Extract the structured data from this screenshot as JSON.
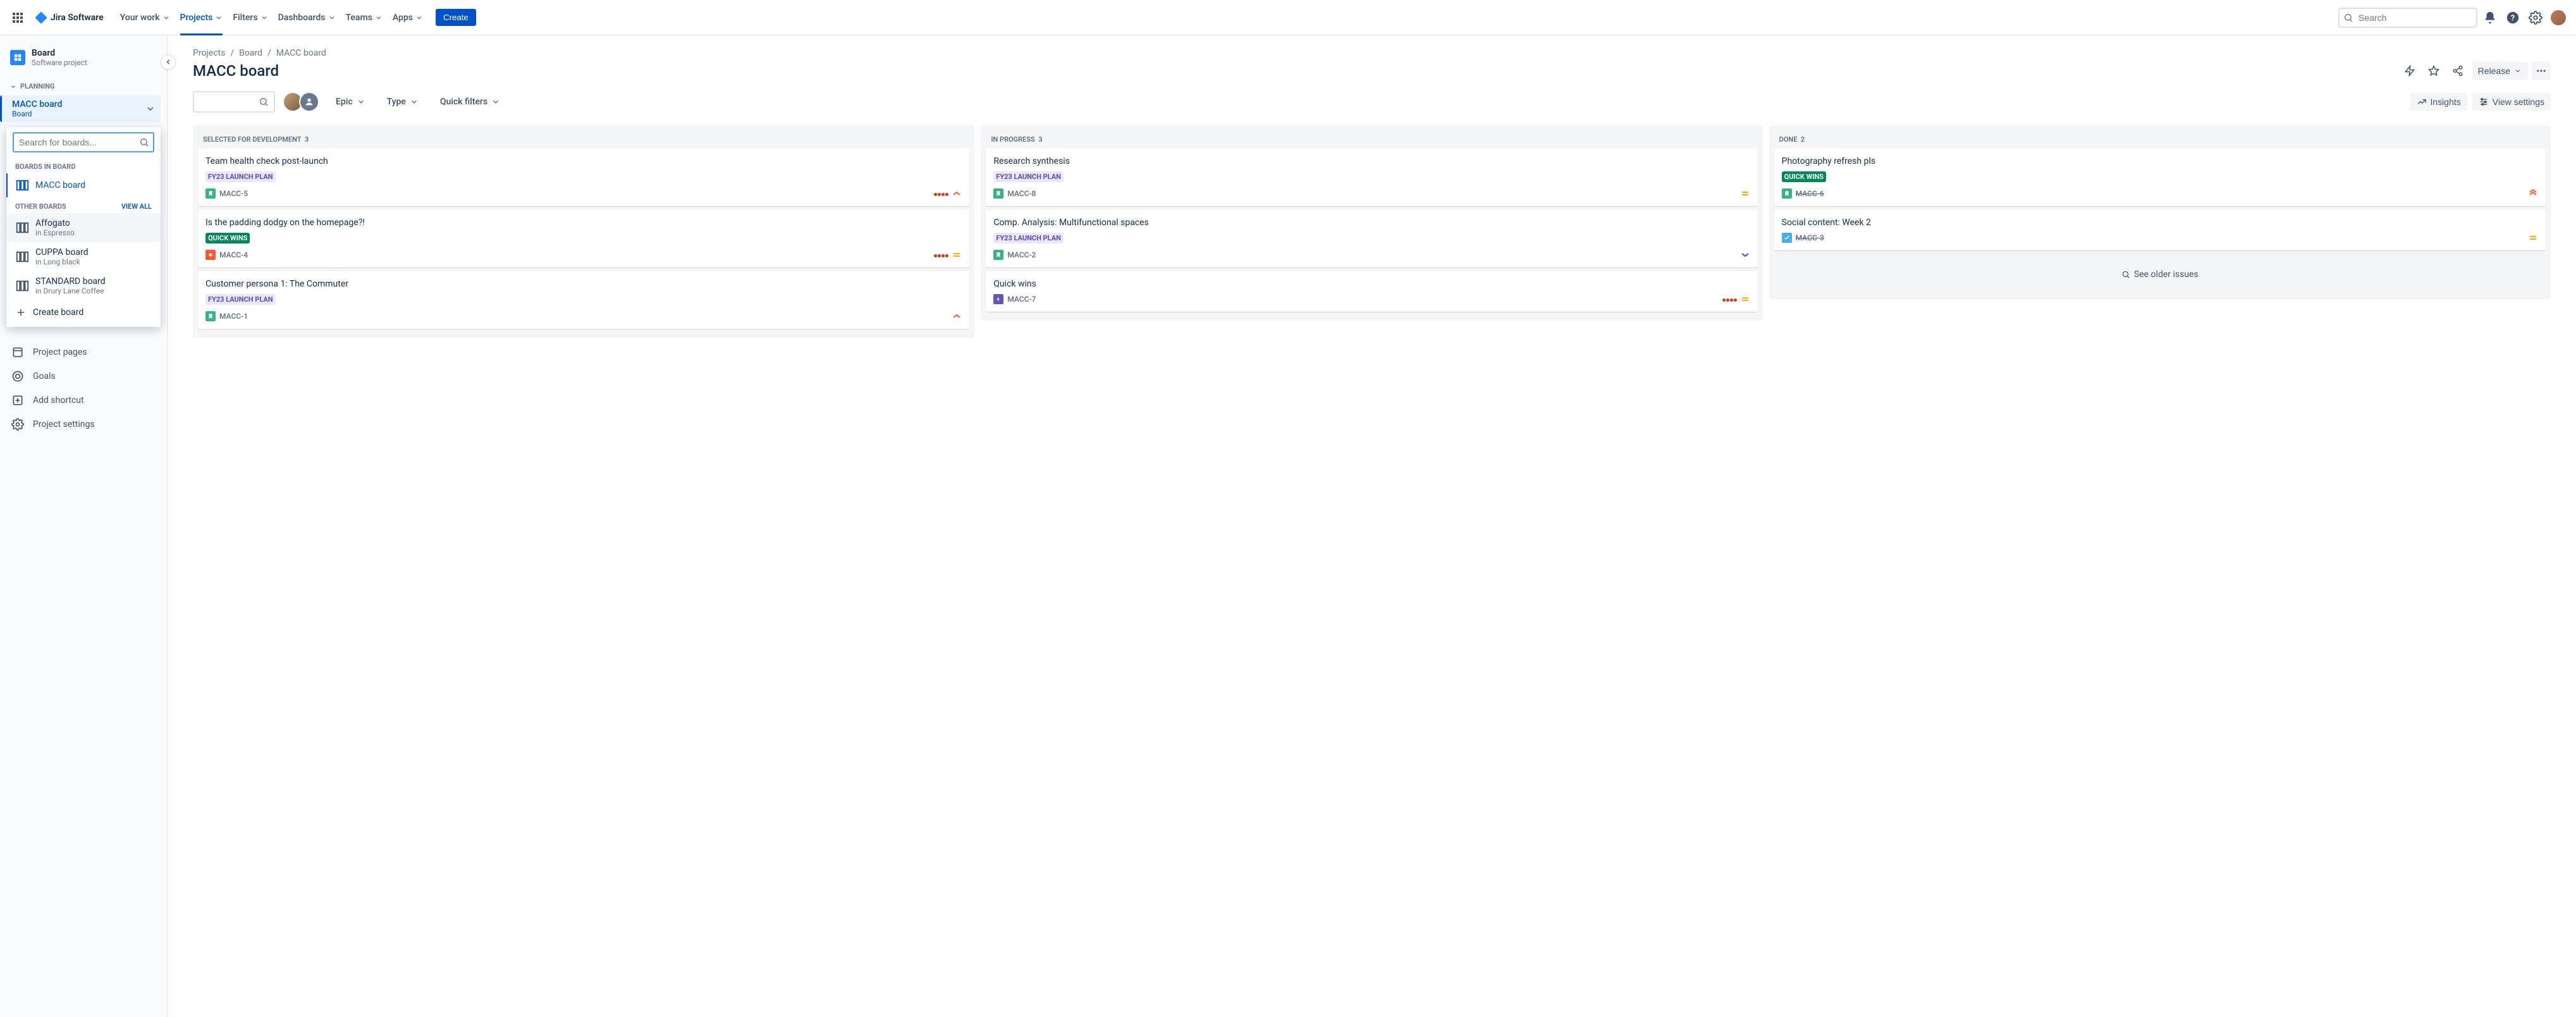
{
  "app": {
    "name": "Jira Software"
  },
  "nav": {
    "items": [
      {
        "label": "Your work"
      },
      {
        "label": "Projects"
      },
      {
        "label": "Filters"
      },
      {
        "label": "Dashboards"
      },
      {
        "label": "Teams"
      },
      {
        "label": "Apps"
      }
    ],
    "create": "Create",
    "search_placeholder": "Search"
  },
  "sidebar": {
    "project": {
      "title": "Board",
      "subtitle": "Software project"
    },
    "section_planning": "PLANNING",
    "current_board": {
      "title": "MACC board",
      "subtitle": "Board"
    },
    "dropdown": {
      "search_placeholder": "Search for boards...",
      "label_boards_in": "BOARDS IN BOARD",
      "active_board": "MACC board",
      "label_other": "OTHER BOARDS",
      "view_all": "VIEW ALL",
      "others": [
        {
          "title": "Affogato",
          "sub": "in Espresso"
        },
        {
          "title": "CUPPA board",
          "sub": "in Long black"
        },
        {
          "title": "STANDARD board",
          "sub": "in Drury Lane Coffee"
        }
      ],
      "create_board": "Create board"
    },
    "items": [
      {
        "label": "Project pages"
      },
      {
        "label": "Goals"
      },
      {
        "label": "Add shortcut"
      },
      {
        "label": "Project settings"
      }
    ]
  },
  "breadcrumb": [
    "Projects",
    "Board",
    "MACC board"
  ],
  "page": {
    "title": "MACC board"
  },
  "actions": {
    "release": "Release",
    "insights": "Insights",
    "view_settings": "View settings"
  },
  "filters": {
    "epic": "Epic",
    "type": "Type",
    "quick": "Quick filters"
  },
  "columns": [
    {
      "title": "SELECTED FOR DEVELOPMENT",
      "count": "3",
      "cards": [
        {
          "title": "Team health check post-launch",
          "tag": "FY23 LAUNCH PLAN",
          "tagStyle": "purple",
          "type": "story",
          "key": "MACC-5",
          "dots": 4,
          "prio": "high"
        },
        {
          "title": "Is the padding dodgy on the homepage?!",
          "tag": "QUICK WINS",
          "tagStyle": "teal",
          "type": "bug",
          "key": "MACC-4",
          "dots": 4,
          "prio": "medium"
        },
        {
          "title": "Customer persona 1: The Commuter",
          "tag": "FY23 LAUNCH PLAN",
          "tagStyle": "purple",
          "type": "story",
          "key": "MACC-1",
          "prio": "high"
        }
      ]
    },
    {
      "title": "IN PROGRESS",
      "count": "3",
      "cards": [
        {
          "title": "Research synthesis",
          "tag": "FY23 LAUNCH PLAN",
          "tagStyle": "purple",
          "type": "story",
          "key": "MACC-8",
          "prio": "medium"
        },
        {
          "title": "Comp. Analysis: Multifunctional spaces",
          "tag": "FY23 LAUNCH PLAN",
          "tagStyle": "purple",
          "type": "story",
          "key": "MACC-2",
          "prio": "low"
        },
        {
          "title": "Quick wins",
          "type": "epic",
          "key": "MACC-7",
          "dots": 4,
          "prio": "medium"
        }
      ]
    },
    {
      "title": "DONE",
      "count": "2",
      "cards": [
        {
          "title": "Photography refresh pls",
          "tag": "QUICK WINS",
          "tagStyle": "teal",
          "type": "story",
          "key": "MACC-6",
          "done": true,
          "prio": "highest"
        },
        {
          "title": "Social content: Week 2",
          "type": "task",
          "key": "MACC-3",
          "done": true,
          "prio": "medium"
        }
      ],
      "see_older": "See older issues"
    }
  ]
}
